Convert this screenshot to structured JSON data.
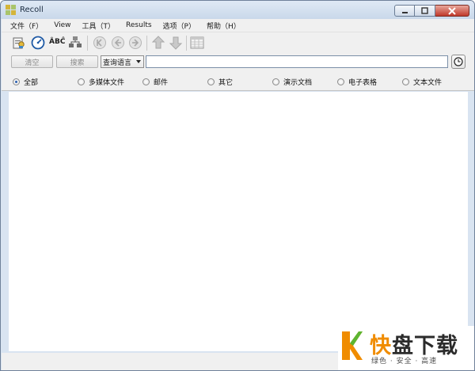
{
  "window": {
    "title": "Recoll"
  },
  "menu": [
    "文件（F）",
    "View",
    "工具（T）",
    "Results",
    "选项（P）",
    "帮助（H）"
  ],
  "toolbar": {
    "icons": [
      "query-index-icon",
      "update-index-icon",
      "spelling-abc-icon",
      "network-icon",
      "first-page-icon",
      "previous-page-icon",
      "next-page-icon",
      "sort-up-icon",
      "sort-down-icon",
      "result-table-icon"
    ],
    "spelling_text": "ÂBĈ"
  },
  "search": {
    "clear_label": "清空",
    "search_label": "搜索",
    "query_language": "查询语言",
    "query_value": ""
  },
  "filters": {
    "selected": "全部",
    "options": [
      "全部",
      "多媒体文件",
      "邮件",
      "其它",
      "演示文档",
      "电子表格",
      "文本文件"
    ]
  },
  "watermark": {
    "brand_first": "快",
    "brand_rest": "盘下载",
    "tagline": "绿色 · 安全 · 高速"
  },
  "colors": {
    "accent": "#f08c00",
    "selected_radio": "#2a5fb0"
  }
}
